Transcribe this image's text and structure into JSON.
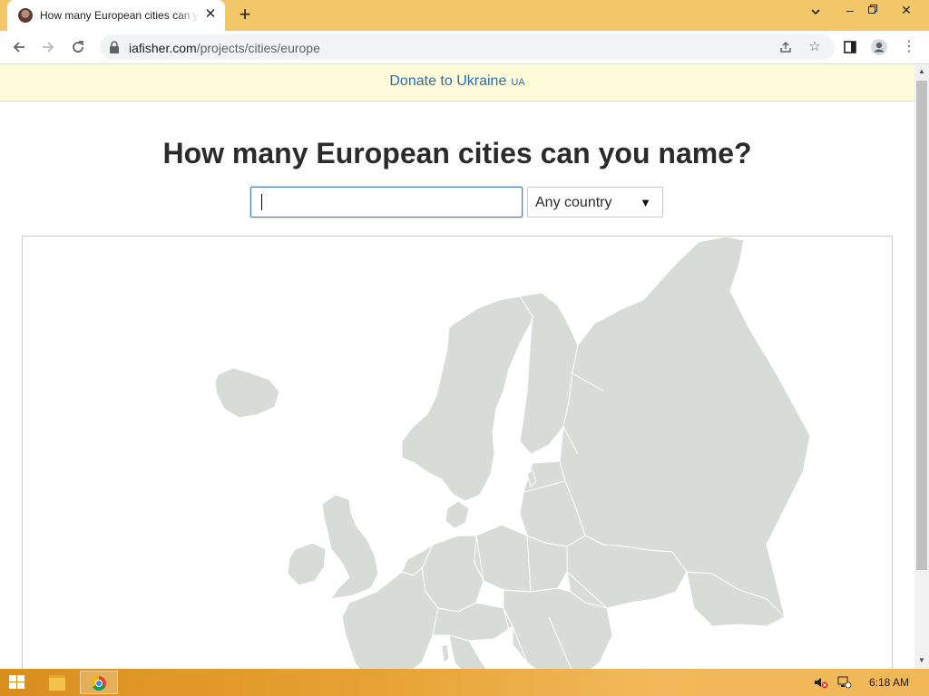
{
  "browser": {
    "tab_title": "How many European cities can you name?",
    "tab_favicon": "profile-photo-favicon",
    "url_host": "iafisher.com",
    "url_path": "/projects/cities/europe",
    "icons": {
      "back": "back-arrow-icon",
      "forward": "forward-arrow-icon",
      "reload": "reload-icon",
      "lock": "lock-icon",
      "share": "share-icon",
      "bookmark": "star-icon",
      "side_panel": "side-panel-icon",
      "profile": "profile-icon",
      "menu": "kebab-menu-icon"
    }
  },
  "page": {
    "donate_text": "Donate to Ukraine",
    "donate_flag": "UA",
    "heading": "How many European cities can you name?",
    "city_input_value": "",
    "country_select_value": "Any country",
    "map": {
      "land_color": "#d7dcd8",
      "border_color": "#ffffff"
    }
  },
  "taskbar": {
    "clock": "6:18 AM",
    "icons": [
      "windows-start-icon",
      "file-explorer-icon",
      "chrome-icon",
      "volume-muted-icon",
      "network-icon"
    ]
  },
  "colors": {
    "tab_strip": "#f1c76a",
    "donate_bg": "#fefbd8",
    "link": "#2a6db5",
    "heading": "#2b2b2b",
    "input_focus": "#4a7cc0"
  }
}
